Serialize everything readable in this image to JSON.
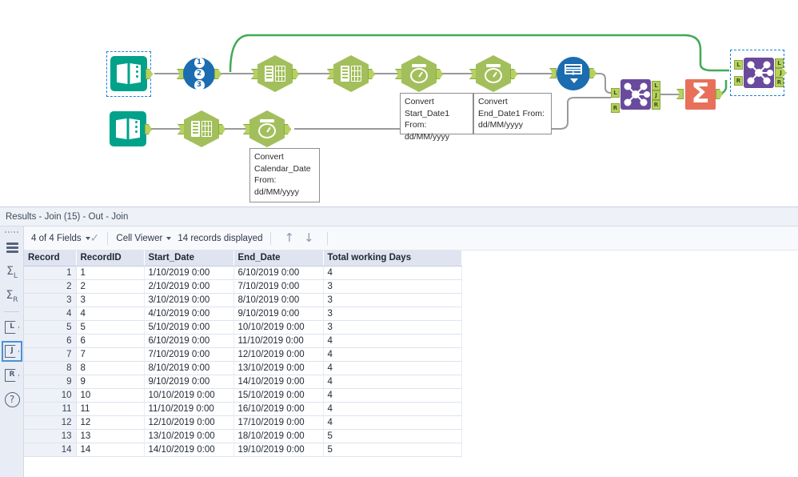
{
  "canvas": {
    "nodes": [
      {
        "id": "input-data-1",
        "label": "Input Data",
        "type": "input-data",
        "selected": true
      },
      {
        "id": "record-id-1",
        "label": "Record ID",
        "type": "record-id",
        "digits": [
          "1",
          "2",
          "3"
        ]
      },
      {
        "id": "select-1",
        "label": "Select",
        "type": "select"
      },
      {
        "id": "select-2",
        "label": "Select",
        "type": "select"
      },
      {
        "id": "datetime-1",
        "label": "DateTime",
        "type": "datetime"
      },
      {
        "id": "datetime-2",
        "label": "DateTime",
        "type": "datetime"
      },
      {
        "id": "generate-rows-1",
        "label": "Generate Rows",
        "type": "generate-rows"
      },
      {
        "id": "join-1",
        "label": "Join",
        "type": "join",
        "ports": [
          "L",
          "J",
          "R"
        ]
      },
      {
        "id": "summarize-1",
        "label": "Summarize",
        "type": "summarize",
        "glyph": "Σ"
      },
      {
        "id": "join-2",
        "label": "Join (15)",
        "type": "join",
        "ports": [
          "L",
          "J",
          "R"
        ],
        "selected": true
      },
      {
        "id": "input-data-2",
        "label": "Input Data",
        "type": "input-data"
      },
      {
        "id": "select-3",
        "label": "Select",
        "type": "select"
      },
      {
        "id": "datetime-3",
        "label": "DateTime",
        "type": "datetime"
      }
    ],
    "annotations": [
      {
        "id": "annot-start-date",
        "lines": [
          "Convert",
          "Start_Date1 From:",
          "dd/MM/yyyy"
        ]
      },
      {
        "id": "annot-end-date",
        "lines": [
          "Convert",
          "End_Date1 From:",
          "dd/MM/yyyy"
        ]
      },
      {
        "id": "annot-calendar-date",
        "lines": [
          "Convert",
          "Calendar_Date",
          "From:",
          "dd/MM/yyyy"
        ]
      }
    ],
    "colors": {
      "input_teal": "#00a28a",
      "blue": "#1b6cb0",
      "hex_green": "#a3bf5c",
      "join_purple": "#6a4a9c",
      "summarize_orange": "#e8705a",
      "port_green": "#b6d25e",
      "wire_gray": "#9a9a9a",
      "wire_green": "#3faa58",
      "selection_blue": "#1f7fd6"
    }
  },
  "results": {
    "title": "Results - Join (15) - Out - Join",
    "toolbar": {
      "fields_label": "4 of 4 Fields",
      "viewer_label": "Cell Viewer",
      "records_label": "14 records displayed",
      "check_glyph": "✓",
      "up_glyph": "↑",
      "down_glyph": "↓"
    },
    "rail": {
      "items": [
        {
          "id": "rail-table",
          "label": "",
          "glyph": "stack",
          "selected": false
        },
        {
          "id": "rail-sum-left",
          "label": "L",
          "glyph": "sigma",
          "selected": false
        },
        {
          "id": "rail-sum-right",
          "label": "R",
          "glyph": "sigma",
          "selected": false
        },
        {
          "id": "rail-left",
          "label": "L",
          "glyph": "pent",
          "selected": false
        },
        {
          "id": "rail-join",
          "label": "J",
          "glyph": "pent",
          "selected": true
        },
        {
          "id": "rail-right",
          "label": "R",
          "glyph": "pent",
          "selected": false
        },
        {
          "id": "rail-help",
          "label": "?",
          "glyph": "question",
          "selected": false
        }
      ]
    },
    "table": {
      "headers": [
        "Record",
        "RecordID",
        "Start_Date",
        "End_Date",
        "Total working Days"
      ],
      "rows": [
        [
          "1",
          "1",
          "1/10/2019 0:00",
          "6/10/2019 0:00",
          "4"
        ],
        [
          "2",
          "2",
          "2/10/2019 0:00",
          "7/10/2019 0:00",
          "3"
        ],
        [
          "3",
          "3",
          "3/10/2019 0:00",
          "8/10/2019 0:00",
          "3"
        ],
        [
          "4",
          "4",
          "4/10/2019 0:00",
          "9/10/2019 0:00",
          "3"
        ],
        [
          "5",
          "5",
          "5/10/2019 0:00",
          "10/10/2019 0:00",
          "3"
        ],
        [
          "6",
          "6",
          "6/10/2019 0:00",
          "11/10/2019 0:00",
          "4"
        ],
        [
          "7",
          "7",
          "7/10/2019 0:00",
          "12/10/2019 0:00",
          "4"
        ],
        [
          "8",
          "8",
          "8/10/2019 0:00",
          "13/10/2019 0:00",
          "4"
        ],
        [
          "9",
          "9",
          "9/10/2019 0:00",
          "14/10/2019 0:00",
          "4"
        ],
        [
          "10",
          "10",
          "10/10/2019 0:00",
          "15/10/2019 0:00",
          "4"
        ],
        [
          "11",
          "11",
          "11/10/2019 0:00",
          "16/10/2019 0:00",
          "4"
        ],
        [
          "12",
          "12",
          "12/10/2019 0:00",
          "17/10/2019 0:00",
          "4"
        ],
        [
          "13",
          "13",
          "13/10/2019 0:00",
          "18/10/2019 0:00",
          "5"
        ],
        [
          "14",
          "14",
          "14/10/2019 0:00",
          "19/10/2019 0:00",
          "5"
        ]
      ]
    }
  }
}
